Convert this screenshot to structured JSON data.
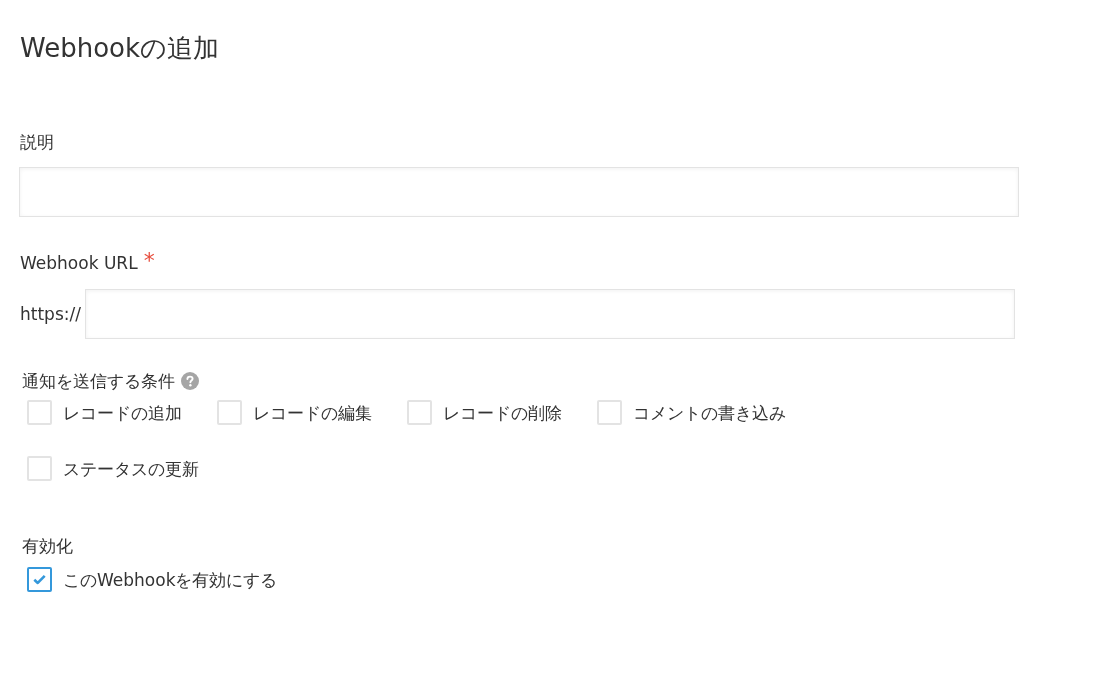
{
  "title": "Webhookの追加",
  "description": {
    "label": "説明"
  },
  "webhook_url": {
    "label": "Webhook URL",
    "required_mark": "*",
    "prefix": "https://"
  },
  "conditions": {
    "label": "通知を送信する条件",
    "options": [
      {
        "label": "レコードの追加",
        "checked": false
      },
      {
        "label": "レコードの編集",
        "checked": false
      },
      {
        "label": "レコードの削除",
        "checked": false
      },
      {
        "label": "コメントの書き込み",
        "checked": false
      },
      {
        "label": "ステータスの更新",
        "checked": false
      }
    ]
  },
  "activation": {
    "label": "有効化",
    "options": [
      {
        "label": "このWebhookを有効にする",
        "checked": true
      }
    ]
  }
}
